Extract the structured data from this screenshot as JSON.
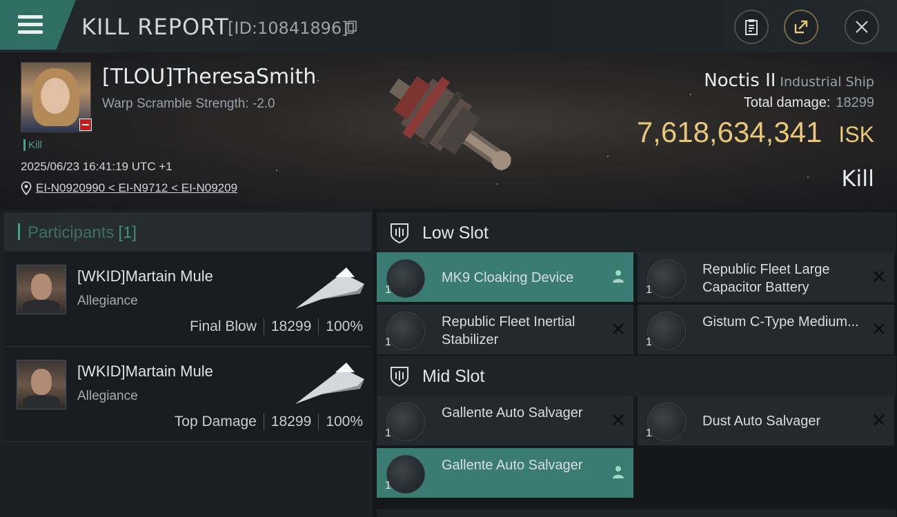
{
  "header": {
    "title": "KILL REPORT",
    "report_id": "[ID:10841896]",
    "icons": [
      "menu-icon",
      "copy-icon",
      "clipboard-icon",
      "share-icon",
      "close-icon"
    ]
  },
  "victim": {
    "name": "[TLOU]TheresaSmith",
    "warp_scramble": "Warp Scramble Strength: -2.0",
    "tag": "Kill",
    "datetime": "2025/06/23 16:41:19 UTC +1",
    "route": "EI-N0920990 < EI-N9712 < EI-N09209"
  },
  "ship": {
    "name": "Noctis II",
    "class": "Industrial Ship",
    "total_damage_label": "Total damage:",
    "total_damage": "18299",
    "isk_value": "7,618,634,341",
    "isk_unit": "ISK",
    "result": "Kill"
  },
  "participants": {
    "title": "Participants",
    "count": "[1]",
    "rows": [
      {
        "name": "[WKID]Martain Mule",
        "alliance": "Allegiance",
        "role": "Final Blow",
        "damage": "18299",
        "percent": "100%"
      },
      {
        "name": "[WKID]Martain Mule",
        "alliance": "Allegiance",
        "role": "Top Damage",
        "damage": "18299",
        "percent": "100%"
      }
    ]
  },
  "fitting": {
    "low_slot": {
      "title": "Low Slot",
      "modules": [
        {
          "qty": "1",
          "name": "MK9 Cloaking Device",
          "state": "active",
          "action_icon": "person-icon"
        },
        {
          "qty": "1",
          "name": "Republic Fleet Large Capacitor Battery",
          "state": "normal",
          "action_icon": "close-icon"
        },
        {
          "qty": "1",
          "name": "Republic Fleet Inertial Stabilizer",
          "state": "normal",
          "action_icon": "close-icon"
        },
        {
          "qty": "1",
          "name": "Gistum C-Type Medium...",
          "state": "normal",
          "action_icon": "close-icon"
        }
      ]
    },
    "mid_slot": {
      "title": "Mid Slot",
      "modules": [
        {
          "qty": "1",
          "name": "Gallente Auto Salvager",
          "state": "normal",
          "action_icon": "close-icon"
        },
        {
          "qty": "1",
          "name": "Dust Auto Salvager",
          "state": "normal",
          "action_icon": "close-icon"
        },
        {
          "qty": "1",
          "name": "Gallente Auto Salvager",
          "state": "active",
          "action_icon": "person-icon"
        }
      ]
    }
  },
  "colors": {
    "accent_teal": "#3a7c71",
    "isk_gold": "#e8c878",
    "badge_red": "#c21d1d"
  }
}
